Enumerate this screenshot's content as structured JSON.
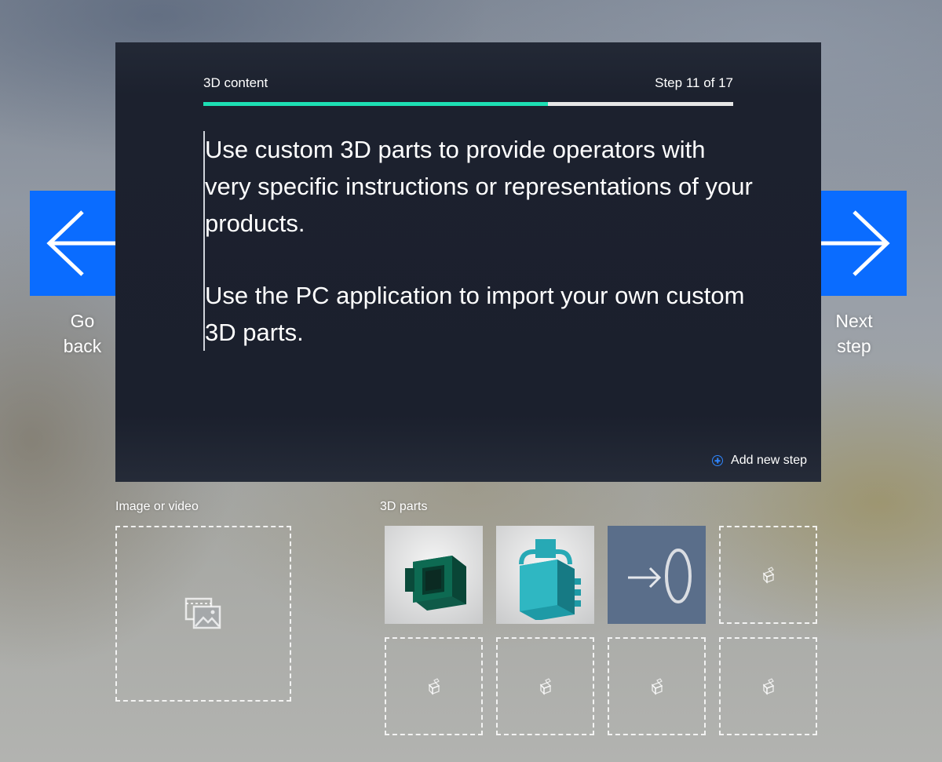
{
  "panel": {
    "section_title": "3D content",
    "step_counter": "Step 11 of 17",
    "progress": 0.65,
    "instruction_paragraphs": [
      "Use custom 3D parts to provide operators with very specific instructions or representations of your products.",
      "Use the PC application to import your own custom 3D parts."
    ],
    "add_step_label": "Add new step"
  },
  "navigation": {
    "back": {
      "line1": "Go",
      "line2": "back",
      "icon": "arrow-left-icon"
    },
    "next": {
      "line1": "Next",
      "line2": "step",
      "icon": "arrow-right-icon"
    }
  },
  "media": {
    "title": "Image or video",
    "icon": "image-gallery-icon"
  },
  "parts": {
    "title": "3D parts",
    "slots": [
      {
        "state": "filled",
        "content": "green-connector-part"
      },
      {
        "state": "filled",
        "content": "teal-block-part"
      },
      {
        "state": "filled",
        "content": "arrow-ring-part"
      },
      {
        "state": "empty",
        "icon": "cube-icon"
      },
      {
        "state": "empty",
        "icon": "cube-icon"
      },
      {
        "state": "empty",
        "icon": "cube-icon"
      },
      {
        "state": "empty",
        "icon": "cube-icon"
      },
      {
        "state": "empty",
        "icon": "cube-icon"
      }
    ]
  },
  "colors": {
    "accent_blue": "#0a6cff",
    "progress_green": "#1ddfb4",
    "panel_bg": "#1b202d"
  }
}
